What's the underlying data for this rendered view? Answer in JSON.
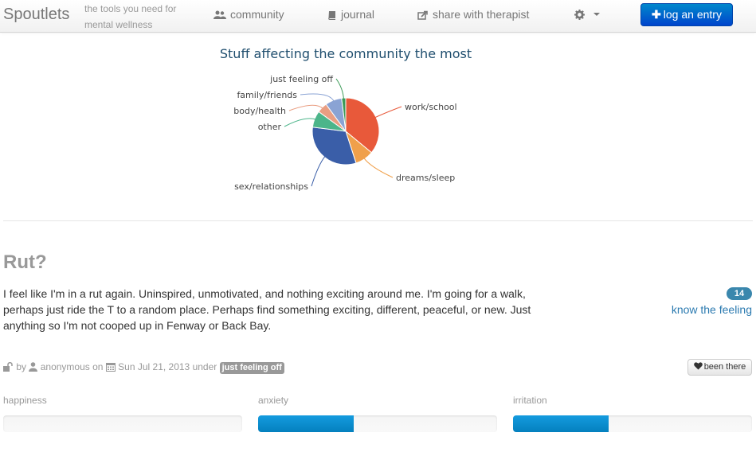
{
  "navbar": {
    "brand": "Spoutlets",
    "tagline_line1": "the tools you need for",
    "tagline_line2": "mental wellness",
    "community_label": "community",
    "journal_label": "journal",
    "share_label": "share with therapist",
    "log_entry_label": "log an entry",
    "icons": {
      "community": "users-icon",
      "journal": "book-icon",
      "share": "share-icon",
      "settings": "gear-icon",
      "log": "plus-icon"
    }
  },
  "chart_data": {
    "type": "pie",
    "title": "Stuff affecting the community the most",
    "slices": [
      {
        "label": "work/school",
        "value": 36,
        "color": "#e8593a"
      },
      {
        "label": "dreams/sleep",
        "value": 9,
        "color": "#f0a04b"
      },
      {
        "label": "sex/relationships",
        "value": 32,
        "color": "#3a5ea8"
      },
      {
        "label": "other",
        "value": 8,
        "color": "#4cb58a"
      },
      {
        "label": "body/health",
        "value": 5,
        "color": "#e99e82"
      },
      {
        "label": "family/friends",
        "value": 8,
        "color": "#8aa3d4"
      },
      {
        "label": "just feeling off",
        "value": 2,
        "color": "#3b9a57"
      }
    ]
  },
  "post": {
    "title": "Rut?",
    "body": "I feel like I'm in a rut again. Uninspired, unmotivated, and nothing exciting around me. I'm going for a walk, perhaps just ride the T to a random place. Perhaps find something exciting, different, peaceful, or new. Just anything so I'm not cooped up in Fenway or Back Bay.",
    "feel_count": "14",
    "know_feeling_label": "know the feeling",
    "meta": {
      "by": "by",
      "author": "anonymous",
      "on": "on",
      "date": "Sun Jul 21, 2013",
      "under": "under",
      "category": "just feeling off"
    },
    "been_there_label": "been there"
  },
  "meters": [
    {
      "label": "happiness",
      "value": 0,
      "unit": "fraction"
    },
    {
      "label": "anxiety",
      "value": 0.4,
      "unit": "fraction"
    },
    {
      "label": "irritation",
      "value": 0.4,
      "unit": "fraction"
    }
  ]
}
